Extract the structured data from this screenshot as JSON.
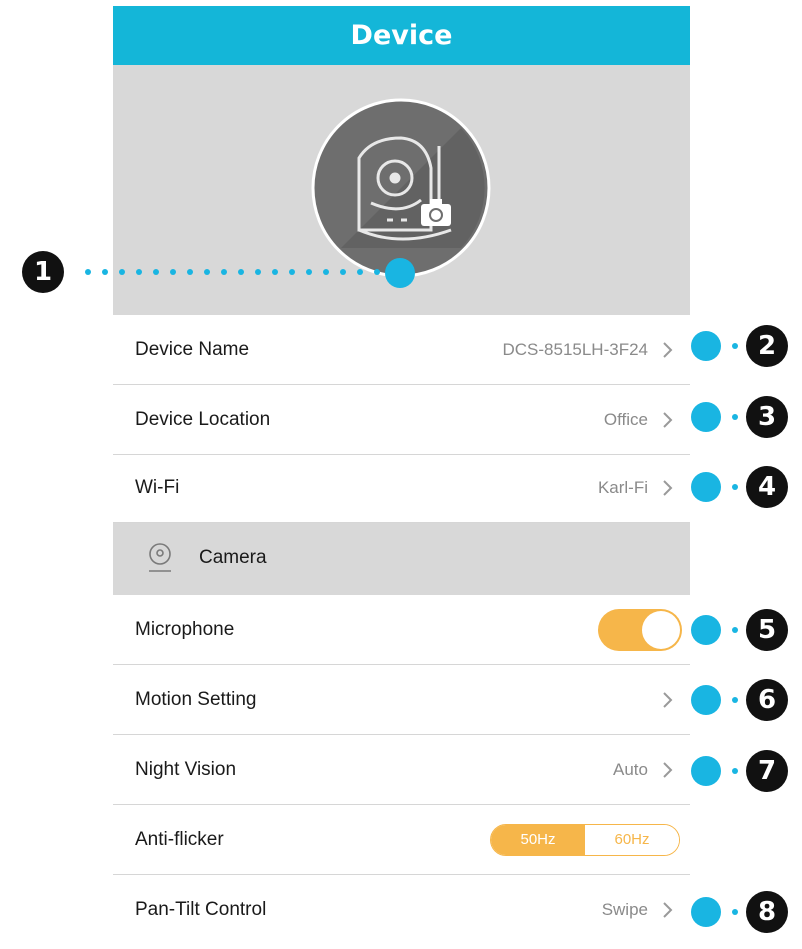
{
  "header": {
    "title": "Device"
  },
  "rows": [
    {
      "label": "Device Name",
      "value": "DCS-8515LH-3F24"
    },
    {
      "label": "Device Location",
      "value": "Office"
    },
    {
      "label": "Wi-Fi",
      "value": "Karl-Fi"
    }
  ],
  "section": {
    "label": "Camera",
    "icon": "camera-icon"
  },
  "camera_rows": [
    {
      "label": "Microphone",
      "toggle_on": true
    },
    {
      "label": "Motion Setting",
      "value": ""
    },
    {
      "label": "Night Vision",
      "value": "Auto"
    },
    {
      "label": "Anti-flicker",
      "options": [
        "50Hz",
        "60Hz"
      ],
      "selected": "50Hz"
    },
    {
      "label": "Pan-Tilt Control",
      "value": "Swipe"
    }
  ],
  "callouts": [
    "1",
    "2",
    "3",
    "4",
    "5",
    "6",
    "7",
    "8"
  ],
  "colors": {
    "header": "#14b6d8",
    "accent": "#f6b64a",
    "callout_dot": "#19b5e2"
  }
}
